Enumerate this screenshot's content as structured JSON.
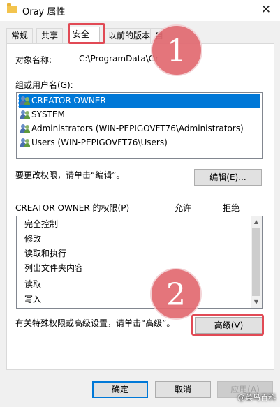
{
  "window": {
    "title": "Oray 属性",
    "close_glyph": "✕"
  },
  "tabs": [
    {
      "label": "常规"
    },
    {
      "label": "共享"
    },
    {
      "label": "安全"
    },
    {
      "label": "以前的版本"
    },
    {
      "label": "自"
    }
  ],
  "security": {
    "object_name_label": "对象名称:",
    "object_name_value": "C:\\ProgramData\\Or",
    "groups_label_pre": "组或用户名(",
    "groups_label_key": "G",
    "groups_label_post": "):",
    "principals": [
      {
        "name": "CREATOR OWNER"
      },
      {
        "name": "SYSTEM"
      },
      {
        "name": "Administrators (WIN-PEPIGOVFT76\\Administrators)"
      },
      {
        "name": "Users (WIN-PEPIGOVFT76\\Users)"
      }
    ],
    "edit_hint": "要更改权限，请单击“编辑”。",
    "edit_button": "编辑(E)...",
    "perm_header_pre": "CREATOR OWNER 的权限(",
    "perm_header_key": "P",
    "perm_header_post": ")",
    "allow_col": "允许",
    "deny_col": "拒绝",
    "permissions": [
      {
        "name": "完全控制"
      },
      {
        "name": "修改"
      },
      {
        "name": "读取和执行"
      },
      {
        "name": "列出文件夹内容"
      },
      {
        "name": "读取"
      },
      {
        "name": "写入"
      }
    ],
    "advanced_hint": "有关特殊权限或高级设置，请单击“高级”。",
    "advanced_button": "高级(V)"
  },
  "footer": {
    "ok": "确定",
    "cancel": "取消",
    "apply": "应用(A)"
  },
  "annotations": {
    "badge1": "1",
    "badge2": "2",
    "highlight_color": "#e14a55",
    "badge_color": "#e26b72"
  },
  "watermark": "@菜鸟百科",
  "colors": {
    "selection": "#0078d7"
  }
}
